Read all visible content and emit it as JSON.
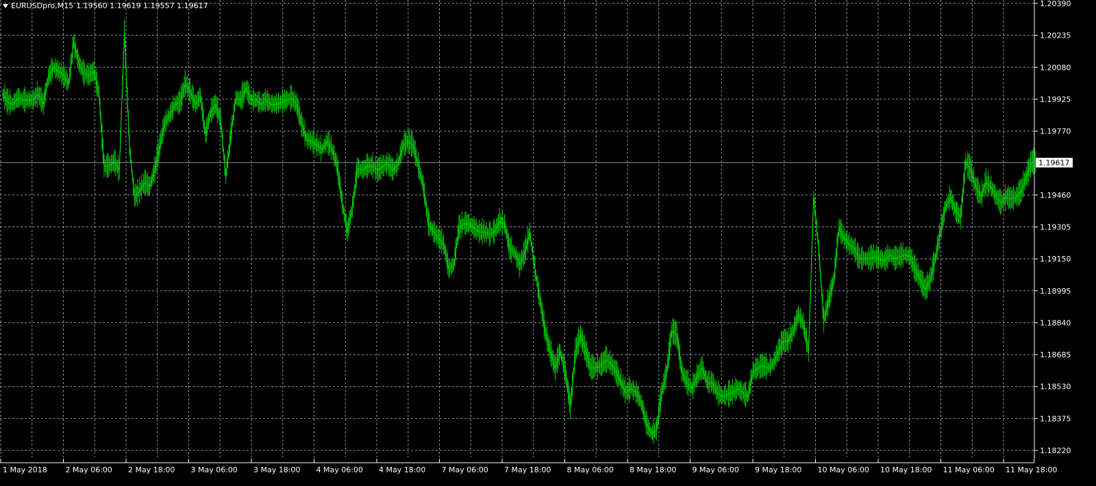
{
  "header": {
    "symbol": "EURUSDpro,M15",
    "ohlc": "1.19560 1.19619 1.19557 1.19617"
  },
  "colors": {
    "background": "#000000",
    "grid": "#8899aa",
    "candle": "#00d000",
    "axis": "#ffffff",
    "price_line": "#8090a0",
    "price_box_bg": "#ffffff",
    "price_box_fg": "#000000"
  },
  "chart_data": {
    "type": "line",
    "title": "EURUSDpro,M15",
    "ylim": [
      1.1822,
      1.2039
    ],
    "y_ticks": [
      "1.20390",
      "1.20235",
      "1.20080",
      "1.19925",
      "1.19770",
      "1.19460",
      "1.19305",
      "1.19150",
      "1.18995",
      "1.18840",
      "1.18685",
      "1.18530",
      "1.18375",
      "1.18220"
    ],
    "current_price": "1.19617",
    "x_ticks": [
      "1 May 2018",
      "2 May 06:00",
      "2 May 18:00",
      "3 May 06:00",
      "3 May 18:00",
      "4 May 06:00",
      "4 May 18:00",
      "7 May 06:00",
      "7 May 18:00",
      "8 May 06:00",
      "8 May 18:00",
      "9 May 06:00",
      "9 May 18:00",
      "10 May 06:00",
      "10 May 18:00",
      "11 May 06:00",
      "11 May 18:00"
    ],
    "grid": true,
    "series": [
      {
        "values": [
          1.1995,
          1.1991,
          1.199,
          1.1993,
          1.1992,
          1.1992,
          1.1992,
          1.1995,
          1.199,
          1.2003,
          1.2008,
          1.2006,
          1.2004,
          1.2,
          1.202,
          1.201,
          1.2005,
          1.2004,
          1.2006,
          1.1995,
          1.196,
          1.196,
          1.1962,
          1.1958,
          1.2025,
          1.197,
          1.1945,
          1.1948,
          1.1952,
          1.195,
          1.1958,
          1.197,
          1.1981,
          1.1985,
          1.199,
          1.1991,
          1.2,
          1.1996,
          1.199,
          1.1994,
          1.1975,
          1.1986,
          1.199,
          1.1982,
          1.1955,
          1.1975,
          1.1993,
          1.1992,
          1.1998,
          1.1992,
          1.1992,
          1.199,
          1.1992,
          1.199,
          1.199,
          1.1991,
          1.1992,
          1.1993,
          1.199,
          1.198,
          1.1973,
          1.1972,
          1.197,
          1.1968,
          1.1972,
          1.1968,
          1.196,
          1.1942,
          1.1928,
          1.194,
          1.1959,
          1.1958,
          1.196,
          1.196,
          1.1958,
          1.196,
          1.1961,
          1.1958,
          1.1961,
          1.197,
          1.1972,
          1.197,
          1.196,
          1.195,
          1.1932,
          1.1928,
          1.1925,
          1.1922,
          1.191,
          1.1912,
          1.193,
          1.1932,
          1.1932,
          1.193,
          1.1928,
          1.1928,
          1.1927,
          1.1928,
          1.1933,
          1.1932,
          1.192,
          1.1918,
          1.1912,
          1.1918,
          1.1928,
          1.191,
          1.1895,
          1.188,
          1.187,
          1.1862,
          1.187,
          1.186,
          1.1843,
          1.187,
          1.1878,
          1.187,
          1.1862,
          1.1862,
          1.1863,
          1.1866,
          1.1864,
          1.186,
          1.1855,
          1.185,
          1.1852,
          1.185,
          1.1845,
          1.1835,
          1.183,
          1.1832,
          1.185,
          1.186,
          1.188,
          1.1878,
          1.186,
          1.1855,
          1.1852,
          1.1858,
          1.1862,
          1.1855,
          1.1855,
          1.185,
          1.1848,
          1.1849,
          1.185,
          1.1852,
          1.185,
          1.1848,
          1.186,
          1.1862,
          1.1863,
          1.1862,
          1.1864,
          1.187,
          1.1875,
          1.1875,
          1.188,
          1.1888,
          1.1883,
          1.187,
          1.1945,
          1.192,
          1.1885,
          1.1895,
          1.1905,
          1.193,
          1.1925,
          1.1922,
          1.192,
          1.1915,
          1.1915,
          1.1915,
          1.1916,
          1.1915,
          1.1914,
          1.1917,
          1.1915,
          1.1916,
          1.1917,
          1.1916,
          1.191,
          1.1905,
          1.19,
          1.1905,
          1.1915,
          1.1928,
          1.194,
          1.1945,
          1.1938,
          1.1935,
          1.1962,
          1.1958,
          1.195,
          1.1945,
          1.1952,
          1.195,
          1.1945,
          1.1942,
          1.1945,
          1.1944,
          1.1945,
          1.1948,
          1.1955,
          1.1962
        ]
      }
    ]
  }
}
